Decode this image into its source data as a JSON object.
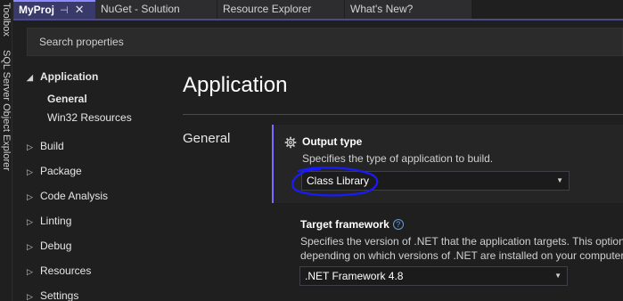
{
  "side_tools": [
    "Toolbox",
    "SQL Server Object Explorer"
  ],
  "tabs": [
    {
      "label": "MyProj",
      "pin": "⊣",
      "close": "✕",
      "active": true
    },
    {
      "label": "NuGet - Solution"
    },
    {
      "label": "Resource Explorer"
    },
    {
      "label": "What's New?"
    }
  ],
  "search": {
    "placeholder": "Search properties"
  },
  "nav": {
    "application": "Application",
    "general": "General",
    "win32": "Win32 Resources",
    "build": "Build",
    "package": "Package",
    "code_analysis": "Code Analysis",
    "linting": "Linting",
    "debug": "Debug",
    "resources": "Resources",
    "settings": "Settings"
  },
  "page": {
    "title": "Application",
    "section": "General"
  },
  "output_type": {
    "title": "Output type",
    "description": "Specifies the type of application to build.",
    "value": "Class Library"
  },
  "target_framework": {
    "title": "Target framework",
    "help": "?",
    "description_1": "Specifies the version of .NET that the application targets. This option",
    "description_2": "depending on which versions of .NET are installed on your computer",
    "value": ".NET Framework 4.8"
  },
  "colors": {
    "accent": "#7a6cff",
    "annotation": "#1a1aff"
  }
}
